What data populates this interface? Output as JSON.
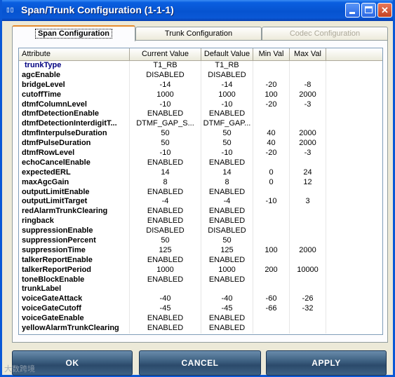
{
  "window": {
    "title": "Span/Trunk Configuration (1-1-1)"
  },
  "tabs": [
    {
      "label": "Span Configuration"
    },
    {
      "label": "Trunk Configuration"
    },
    {
      "label": "Codec Configuration"
    }
  ],
  "grid": {
    "columns": [
      "Attribute",
      "Current Value",
      "Default Value",
      "Min Val",
      "Max Val"
    ],
    "rows": [
      {
        "attr": "trunkType",
        "current": "T1_RB",
        "default": "T1_RB",
        "min": "",
        "max": ""
      },
      {
        "attr": "agcEnable",
        "current": "DISABLED",
        "default": "DISABLED",
        "min": "",
        "max": ""
      },
      {
        "attr": "bridgeLevel",
        "current": "-14",
        "default": "-14",
        "min": "-20",
        "max": "-8"
      },
      {
        "attr": "cutoffTime",
        "current": "1000",
        "default": "1000",
        "min": "100",
        "max": "2000"
      },
      {
        "attr": "dtmfColumnLevel",
        "current": "-10",
        "default": "-10",
        "min": "-20",
        "max": "-3"
      },
      {
        "attr": "dtmfDetectionEnable",
        "current": "ENABLED",
        "default": "ENABLED",
        "min": "",
        "max": ""
      },
      {
        "attr": "dtmfDetectionInterdigitT...",
        "current": "DTMF_GAP_S...",
        "default": "DTMF_GAP...",
        "min": "",
        "max": ""
      },
      {
        "attr": "dtmfInterpulseDuration",
        "current": "50",
        "default": "50",
        "min": "40",
        "max": "2000"
      },
      {
        "attr": "dtmfPulseDuration",
        "current": "50",
        "default": "50",
        "min": "40",
        "max": "2000"
      },
      {
        "attr": "dtmfRowLevel",
        "current": "-10",
        "default": "-10",
        "min": "-20",
        "max": "-3"
      },
      {
        "attr": "echoCancelEnable",
        "current": "ENABLED",
        "default": "ENABLED",
        "min": "",
        "max": ""
      },
      {
        "attr": "expectedERL",
        "current": "14",
        "default": "14",
        "min": "0",
        "max": "24"
      },
      {
        "attr": "maxAgcGain",
        "current": "8",
        "default": "8",
        "min": "0",
        "max": "12"
      },
      {
        "attr": "outputLimitEnable",
        "current": "ENABLED",
        "default": "ENABLED",
        "min": "",
        "max": ""
      },
      {
        "attr": "outputLimitTarget",
        "current": "-4",
        "default": "-4",
        "min": "-10",
        "max": "3"
      },
      {
        "attr": "redAlarmTrunkClearing",
        "current": "ENABLED",
        "default": "ENABLED",
        "min": "",
        "max": ""
      },
      {
        "attr": "ringback",
        "current": "ENABLED",
        "default": "ENABLED",
        "min": "",
        "max": ""
      },
      {
        "attr": "suppressionEnable",
        "current": "DISABLED",
        "default": "DISABLED",
        "min": "",
        "max": ""
      },
      {
        "attr": "suppressionPercent",
        "current": "50",
        "default": "50",
        "min": "",
        "max": ""
      },
      {
        "attr": "suppressionTime",
        "current": "125",
        "default": "125",
        "min": "100",
        "max": "2000"
      },
      {
        "attr": "talkerReportEnable",
        "current": "ENABLED",
        "default": "ENABLED",
        "min": "",
        "max": ""
      },
      {
        "attr": "talkerReportPeriod",
        "current": "1000",
        "default": "1000",
        "min": "200",
        "max": "10000"
      },
      {
        "attr": "toneBlockEnable",
        "current": "ENABLED",
        "default": "ENABLED",
        "min": "",
        "max": ""
      },
      {
        "attr": "trunkLabel",
        "current": "",
        "default": "",
        "min": "",
        "max": ""
      },
      {
        "attr": "voiceGateAttack",
        "current": "-40",
        "default": "-40",
        "min": "-60",
        "max": "-26"
      },
      {
        "attr": "voiceGateCutoff",
        "current": "-45",
        "default": "-45",
        "min": "-66",
        "max": "-32"
      },
      {
        "attr": "voiceGateEnable",
        "current": "ENABLED",
        "default": "ENABLED",
        "min": "",
        "max": ""
      },
      {
        "attr": "yellowAlarmTrunkClearing",
        "current": "ENABLED",
        "default": "ENABLED",
        "min": "",
        "max": ""
      }
    ]
  },
  "buttons": {
    "ok": "OK",
    "cancel": "CANCEL",
    "apply": "APPLY"
  },
  "watermark": "大数跨境",
  "colors": {
    "titlebar": "#0a58d6",
    "button": "#3f6283",
    "selected_text": "#000080",
    "tab_highlight": "#e68b2c"
  }
}
